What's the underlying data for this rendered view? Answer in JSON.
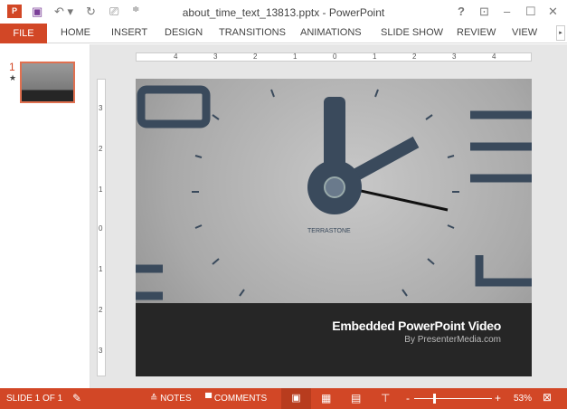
{
  "window": {
    "title": "about_time_text_13813.pptx - PowerPoint"
  },
  "ribbon": {
    "tabs": [
      "FILE",
      "HOME",
      "INSERT",
      "DESIGN",
      "TRANSITIONS",
      "ANIMATIONS",
      "SLIDE SHOW",
      "REVIEW",
      "VIEW"
    ]
  },
  "thumbnails": [
    {
      "number": "1",
      "star": "★"
    }
  ],
  "ruler": {
    "h": [
      "4",
      "3",
      "2",
      "1",
      "0",
      "1",
      "2",
      "3",
      "4"
    ],
    "v": [
      "3",
      "2",
      "1",
      "0",
      "1",
      "2",
      "3"
    ]
  },
  "slide": {
    "clock_brand": "TERRASTONE",
    "caption_title": "Embedded PowerPoint Video",
    "caption_sub": "By PresenterMedia.com"
  },
  "status": {
    "slide": "SLIDE 1 OF 1",
    "notes": "NOTES",
    "comments": "COMMENTS",
    "zoom": "53%",
    "zoom_level": 53
  },
  "colors": {
    "accent": "#d24726",
    "caption_bg": "#262626",
    "clock_marks": "#3a4a5c"
  }
}
